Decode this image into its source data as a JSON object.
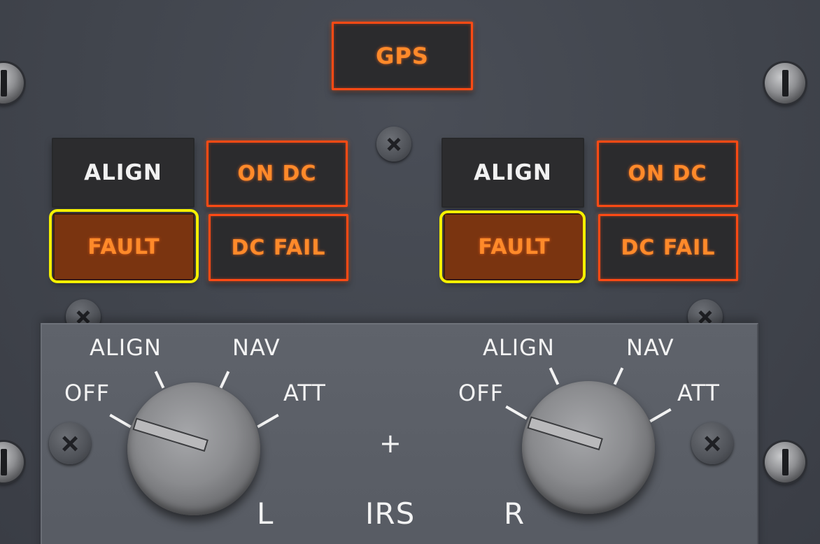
{
  "panel": {
    "gps_light": "GPS",
    "left": {
      "align_light": "ALIGN",
      "on_dc_light": "ON DC",
      "fault_light": "FAULT",
      "dc_fail_light": "DC FAIL"
    },
    "right": {
      "align_light": "ALIGN",
      "on_dc_light": "ON DC",
      "fault_light": "FAULT",
      "dc_fail_light": "DC FAIL"
    }
  },
  "mode_selectors": {
    "left": {
      "positions": [
        "OFF",
        "ALIGN",
        "NAV",
        "ATT"
      ],
      "selected": "OFF",
      "side_label": "L"
    },
    "right": {
      "positions": [
        "OFF",
        "ALIGN",
        "NAV",
        "ATT"
      ],
      "selected": "OFF",
      "side_label": "R"
    },
    "center_symbol": "+",
    "system_label": "IRS"
  },
  "colors": {
    "amber": "#ff8a2a",
    "amber_border": "#ff4a14",
    "highlight": "#f5f000",
    "panel": "#41454d"
  }
}
